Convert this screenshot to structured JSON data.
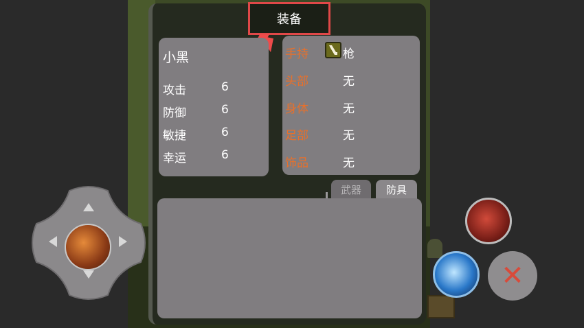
{
  "window": {
    "title": "装备"
  },
  "character": {
    "name": "小黑",
    "stats": [
      {
        "label": "攻击",
        "value": "6"
      },
      {
        "label": "防御",
        "value": "6"
      },
      {
        "label": "敏捷",
        "value": "6"
      },
      {
        "label": "幸运",
        "value": "6"
      }
    ]
  },
  "equipment": {
    "slots": [
      {
        "slot": "手持",
        "item": "枪",
        "icon": "gun-icon"
      },
      {
        "slot": "头部",
        "item": "无"
      },
      {
        "slot": "身体",
        "item": "无"
      },
      {
        "slot": "足部",
        "item": "无"
      },
      {
        "slot": "饰品",
        "item": "无"
      }
    ]
  },
  "tabs": [
    {
      "label": "武器",
      "active": false
    },
    {
      "label": "防具",
      "active": true
    }
  ],
  "controls": {
    "close_glyph": "✕"
  },
  "colors": {
    "slot_label": "#e8702a",
    "card_bg": "#807d80",
    "highlight_border": "#e04848"
  }
}
